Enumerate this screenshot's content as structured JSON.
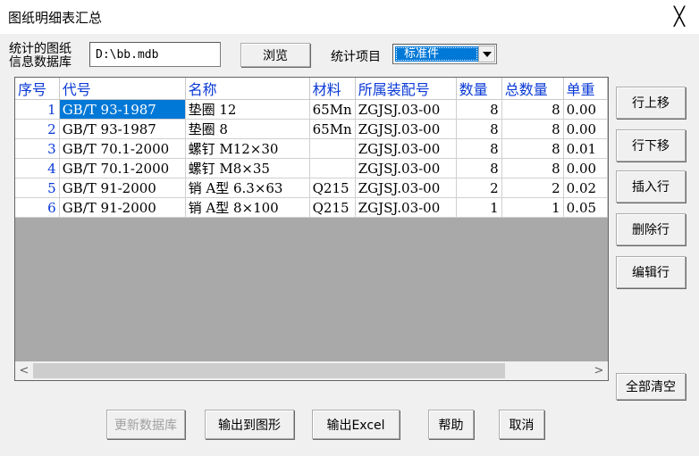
{
  "window": {
    "title": "图纸明细表汇总",
    "close_label": "╳"
  },
  "db": {
    "label_line1": "统计的图纸",
    "label_line2": "信息数据库",
    "value": "D:\\bb.mdb",
    "browse_label": "浏览"
  },
  "stat": {
    "label": "统计项目",
    "selected": "标准件"
  },
  "table": {
    "headers": [
      "序号",
      "代号",
      "名称",
      "材料",
      "所属装配号",
      "数量",
      "总数量",
      "单重"
    ],
    "rows": [
      [
        "1",
        "GB/T 93-1987",
        "垫圈 12",
        "65Mn",
        "ZGJSJ.03-00",
        "8",
        "8",
        "0.00"
      ],
      [
        "2",
        "GB/T 93-1987",
        "垫圈 8",
        "65Mn",
        "ZGJSJ.03-00",
        "8",
        "8",
        "0.00"
      ],
      [
        "3",
        "GB/T 70.1-2000",
        "螺钉 M12×30",
        "",
        "ZGJSJ.03-00",
        "8",
        "8",
        "0.01"
      ],
      [
        "4",
        "GB/T 70.1-2000",
        "螺钉 M8×35",
        "",
        "ZGJSJ.03-00",
        "8",
        "8",
        "0.00"
      ],
      [
        "5",
        "GB/T 91-2000",
        "销 A型 6.3×63",
        "Q215",
        "ZGJSJ.03-00",
        "2",
        "2",
        "0.02"
      ],
      [
        "6",
        "GB/T 91-2000",
        "销 A型 8×100",
        "Q215",
        "ZGJSJ.03-00",
        "1",
        "1",
        "0.05"
      ]
    ]
  },
  "scroll": {
    "left": "<",
    "right": ">"
  },
  "side_buttons": {
    "move_up": "行上移",
    "move_down": "行下移",
    "insert": "插入行",
    "delete": "删除行",
    "edit": "编辑行",
    "clear_all": "全部清空"
  },
  "bottom_buttons": {
    "update_db": "更新数据库",
    "export_drawing": "输出到图形",
    "export_excel": "输出Excel",
    "help": "帮助",
    "cancel": "取消"
  }
}
